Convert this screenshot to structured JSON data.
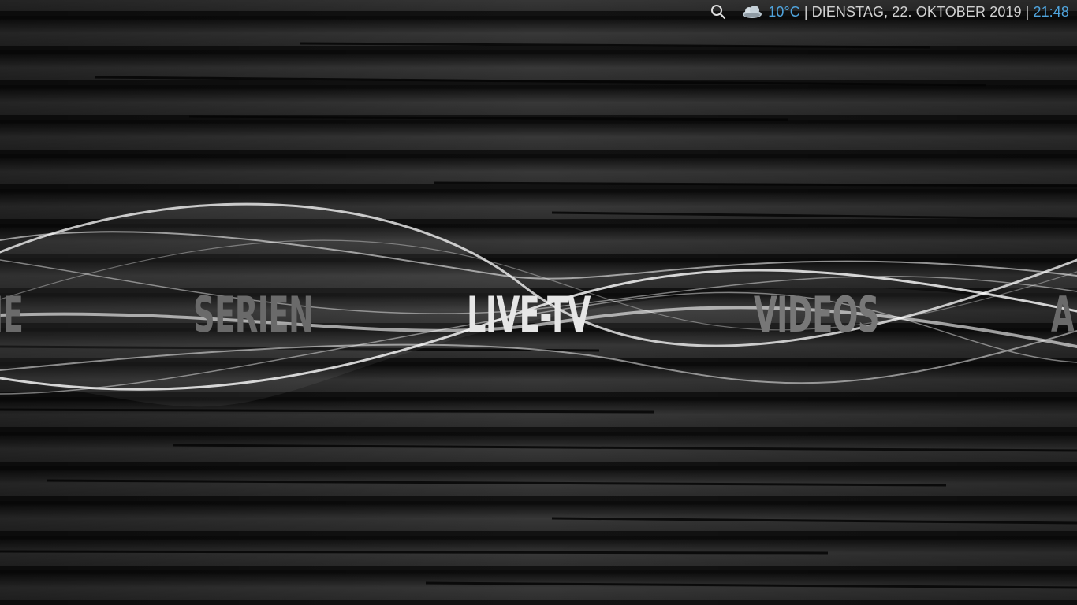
{
  "topbar": {
    "search_icon": "search-icon",
    "weather_icon": "cloud-icon",
    "temperature": "10°C",
    "separator": "|",
    "date": "DIENSTAG, 22. OKTOBER 2019",
    "time": "21:48"
  },
  "main_menu": {
    "items": [
      {
        "label": "ME"
      },
      {
        "label": "SERIEN"
      },
      {
        "label": "LIVE-TV"
      },
      {
        "label": "VIDEOS"
      },
      {
        "label": "A"
      }
    ],
    "selected": "LIVE-TV"
  },
  "colors": {
    "accent": "#4fa3dc",
    "text": "#d0d0d0",
    "menu_active": "#e6e6e6",
    "menu_inactive": "#6a6a6a"
  }
}
